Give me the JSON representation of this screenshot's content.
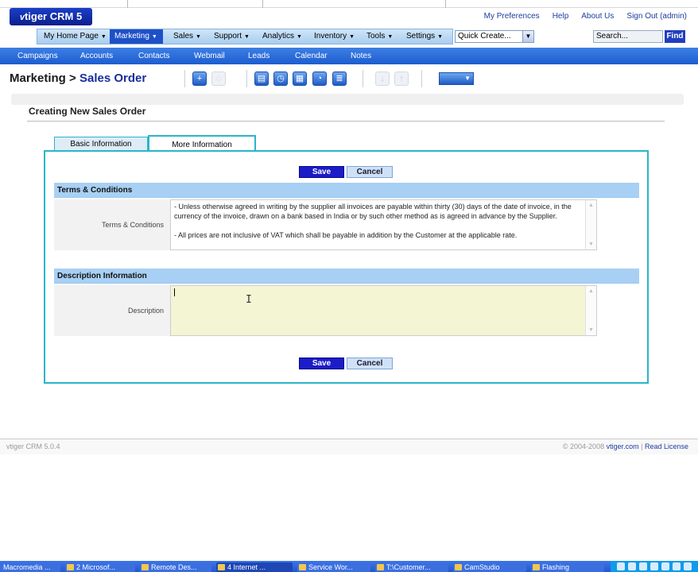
{
  "app": {
    "logo_text": "tiger CRM 5",
    "logo_v": "v"
  },
  "top_links": [
    "My Preferences",
    "Help",
    "About Us",
    "Sign Out (admin)"
  ],
  "main_nav": {
    "tabs": [
      {
        "label": "My Home Page",
        "active": false
      },
      {
        "label": "Marketing",
        "active": true
      },
      {
        "label": "Sales",
        "active": false
      },
      {
        "label": "Support",
        "active": false
      },
      {
        "label": "Analytics",
        "active": false
      },
      {
        "label": "Inventory",
        "active": false
      },
      {
        "label": "Tools",
        "active": false
      },
      {
        "label": "Settings",
        "active": false
      }
    ],
    "quick_create": "Quick Create...",
    "search_placeholder": "Search...",
    "find_label": "Find"
  },
  "sub_nav": [
    "Campaigns",
    "Accounts",
    "Contacts",
    "Webmail",
    "Leads",
    "Calendar",
    "Notes"
  ],
  "page": {
    "breadcrumb_module": "Marketing",
    "breadcrumb_sep": " > ",
    "breadcrumb_page": "Sales Order",
    "section_title": "Creating New Sales Order"
  },
  "tabs": {
    "basic": "Basic Information",
    "more": "More Information"
  },
  "form": {
    "save_label": "Save",
    "cancel_label": "Cancel",
    "terms_block": "Terms & Conditions",
    "terms_label": "Terms & Conditions",
    "terms_line1": "- Unless otherwise agreed in writing by the supplier all invoices are payable within thirty (30) days of the date of invoice, in the currency of the invoice, drawn on a bank based in India or by such other method as is agreed in advance by the Supplier.",
    "terms_line2": " - All prices are not inclusive of VAT which shall be payable in addition by the Customer at the applicable rate.",
    "desc_block": "Description Information",
    "desc_label": "Description",
    "desc_value": ""
  },
  "footer": {
    "version": "vtiger CRM 5.0.4",
    "copyright": "© 2004-2008 ",
    "site_link": "vtiger.com",
    "sep": " | ",
    "license_link": "Read License"
  },
  "taskbar": [
    "Macromedia ...",
    "2 Microsof...",
    "Remote Des...",
    "4 Internet ...",
    "Service Wor...",
    "T:\\Customer...",
    "CamStudio",
    "Flashing"
  ],
  "colors": {
    "accent_blue": "#1e50c8",
    "subnav_blue": "#2d6ddd",
    "block_header": "#a8d0f4",
    "tab_border": "#2ab5c8",
    "save_button": "#1c1cc8"
  }
}
